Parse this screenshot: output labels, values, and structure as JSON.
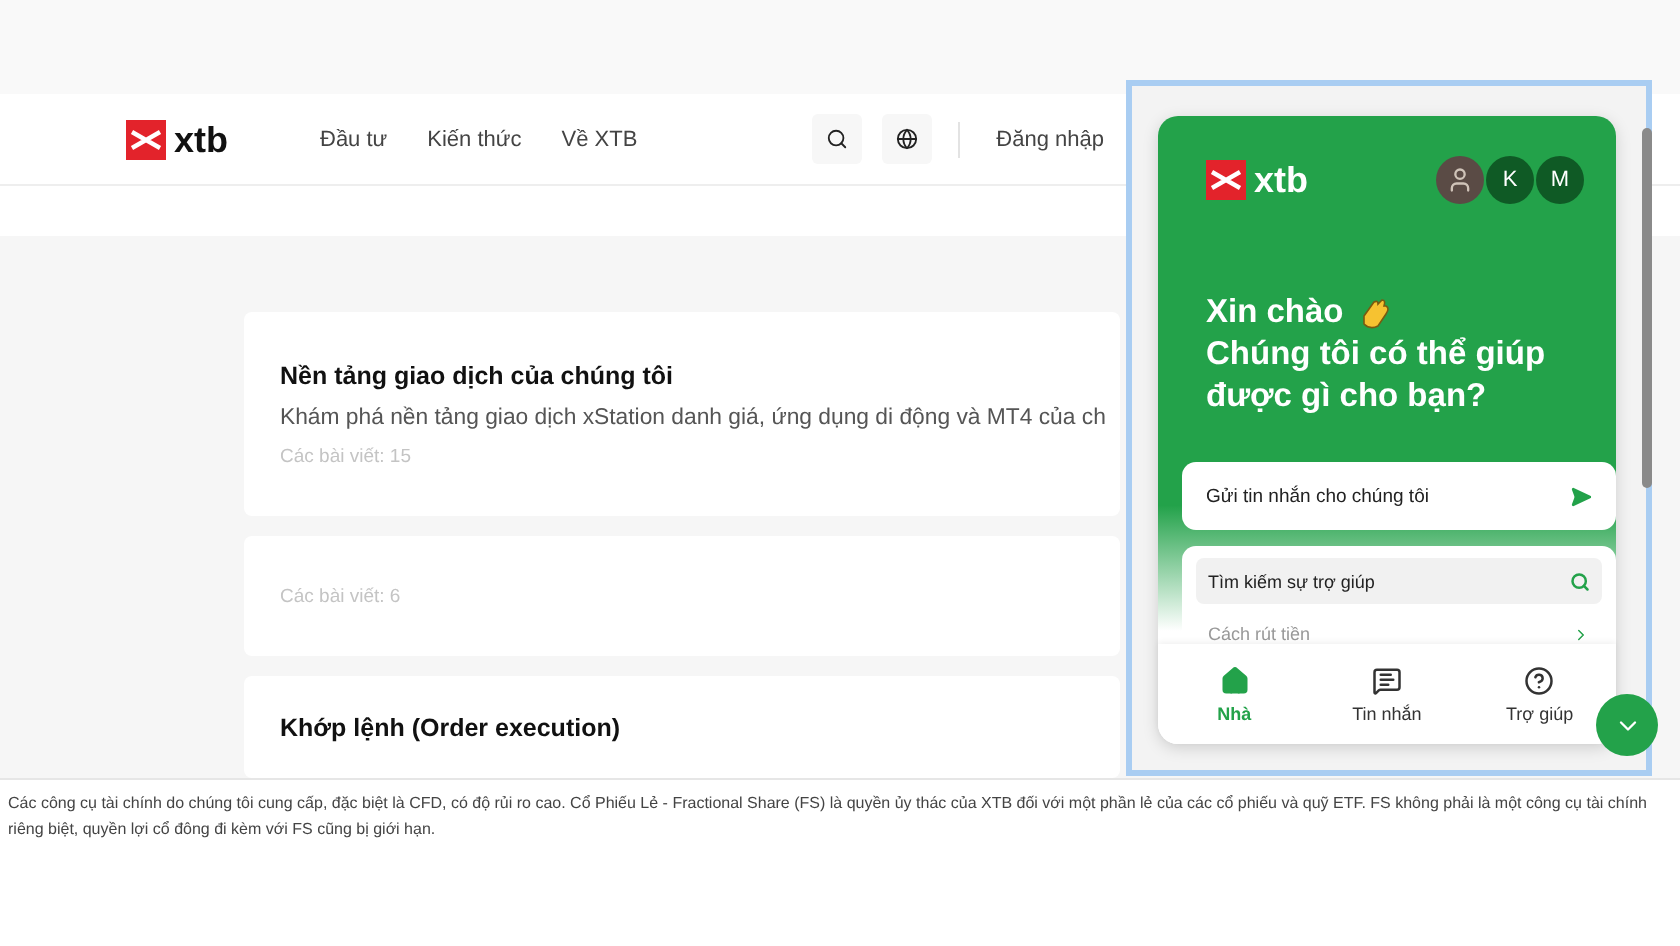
{
  "header": {
    "logo": "xtb",
    "nav": [
      "Đầu tư",
      "Kiến thức",
      "Về XTB"
    ],
    "login": "Đăng nhập"
  },
  "cards": [
    {
      "title": "Nền tảng giao dịch của chúng tôi",
      "description": "Khám phá nền tảng giao dịch xStation danh giá, ứng dụng di động và MT4 của ch",
      "count": "Các bài viết: 15"
    },
    {
      "count": "Các bài viết: 6"
    },
    {
      "title": "Khớp lệnh (Order execution)"
    }
  ],
  "disclaimer": "Các công cụ tài chính do chúng tôi cung cấp, đặc biệt là CFD, có độ rủi ro cao. Cổ Phiếu Lẻ - Fractional Share (FS) là quyền ủy thác của XTB đối với một phần lẻ của các cổ phiếu và quỹ ETF. FS không phải là một công cụ tài chính riêng biệt, quyền lợi cổ đông đi kèm với FS cũng bị giới hạn.",
  "chat": {
    "logo": "xtb",
    "agents": [
      "K",
      "M"
    ],
    "greeting": "Xin chào",
    "question": "Chúng tôi có thể giúp được gì cho bạn?",
    "send_message": "Gửi tin nhắn cho chúng tôi",
    "search": {
      "placeholder": "Tìm kiếm sự trợ giúp"
    },
    "articles": [
      "Cách rút tiền"
    ],
    "tabs": [
      {
        "label": "Nhà",
        "kind": "home",
        "selected": true
      },
      {
        "label": "Tin nhắn",
        "kind": "messages",
        "selected": false
      },
      {
        "label": "Trợ giúp",
        "kind": "help",
        "selected": false
      }
    ]
  }
}
